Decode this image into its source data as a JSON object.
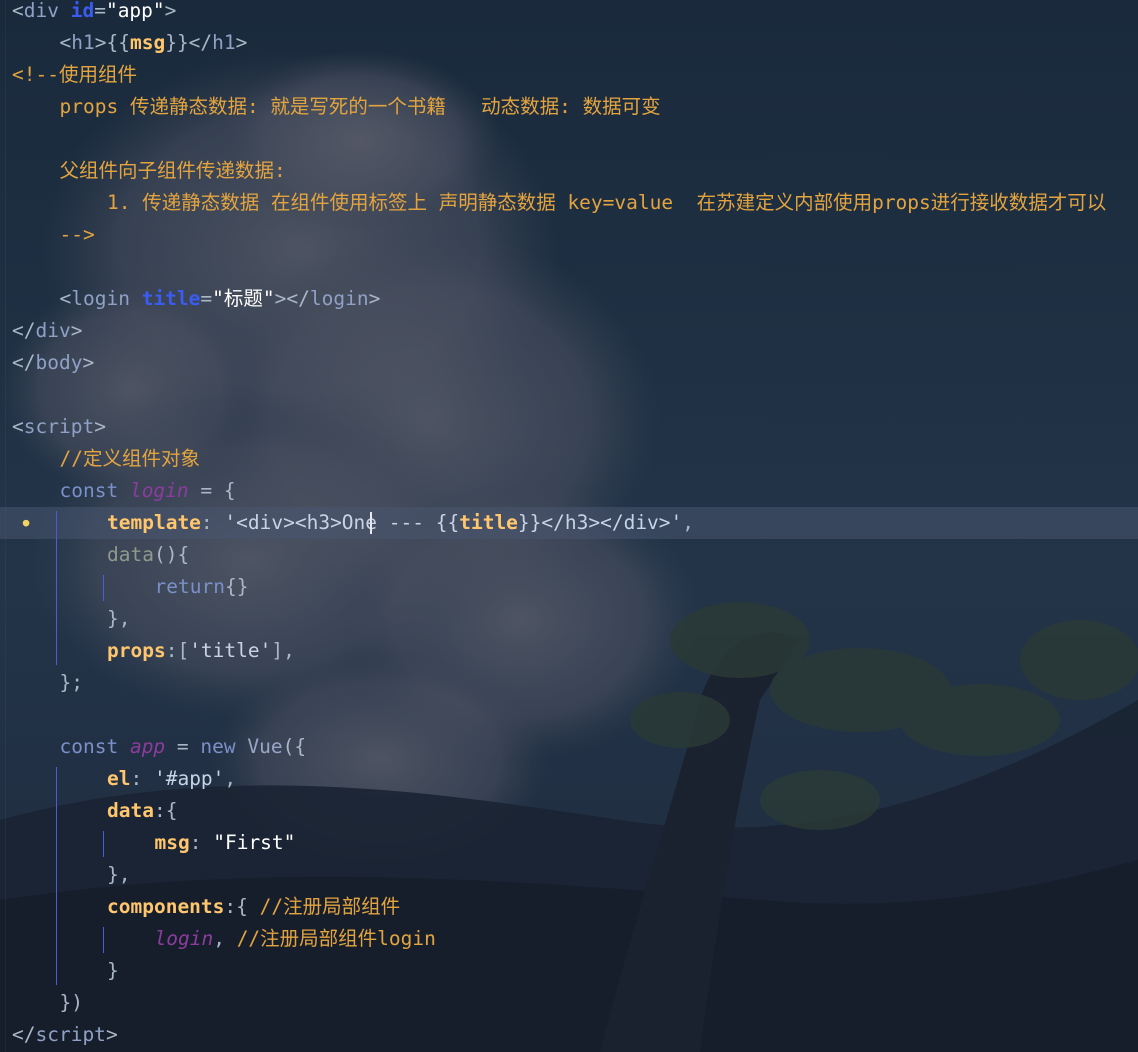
{
  "editor": {
    "lines": [
      {
        "y": 0,
        "indent": 0,
        "tokens": [
          [
            "tag",
            "<"
          ],
          [
            "tagname",
            "div "
          ],
          [
            "attr-kw",
            "id"
          ],
          [
            "tag",
            "="
          ],
          [
            "str",
            "\"app\""
          ],
          [
            "tag",
            ">"
          ]
        ]
      },
      {
        "y": 1,
        "indent": 1,
        "tokens": [
          [
            "tag",
            "<"
          ],
          [
            "tagname",
            "h1"
          ],
          [
            "tag",
            ">{{"
          ],
          [
            "prop",
            "msg"
          ],
          [
            "tag",
            "}}</"
          ],
          [
            "tagname",
            "h1"
          ],
          [
            "tag",
            ">"
          ]
        ]
      },
      {
        "y": 2,
        "indent": 0,
        "tokens": [
          [
            "comment",
            "<!--使用组件"
          ]
        ]
      },
      {
        "y": 3,
        "indent": 1,
        "tokens": [
          [
            "comment",
            "props 传递静态数据: 就是写死的一个书籍   动态数据: 数据可变"
          ]
        ]
      },
      {
        "y": 4,
        "indent": 0,
        "tokens": []
      },
      {
        "y": 5,
        "indent": 1,
        "tokens": [
          [
            "comment",
            "父组件向子组件传递数据:"
          ]
        ]
      },
      {
        "y": 6,
        "indent": 2,
        "tokens": [
          [
            "comment",
            "1. 传递静态数据 在组件使用标签上 声明静态数据 key=value  在苏建定义内部使用props进行接收数据才可以"
          ]
        ]
      },
      {
        "y": 7,
        "indent": 1,
        "tokens": [
          [
            "comment",
            "-->"
          ]
        ]
      },
      {
        "y": 8,
        "indent": 0,
        "tokens": []
      },
      {
        "y": 9,
        "indent": 1,
        "tokens": [
          [
            "tag",
            "<"
          ],
          [
            "tagname",
            "login "
          ],
          [
            "attr-kw",
            "title"
          ],
          [
            "tag",
            "="
          ],
          [
            "str",
            "\"标题\""
          ],
          [
            "tag",
            "></"
          ],
          [
            "tagname",
            "login"
          ],
          [
            "tag",
            ">"
          ]
        ]
      },
      {
        "y": 10,
        "indent": 0,
        "tokens": [
          [
            "tag",
            "</"
          ],
          [
            "tagname",
            "div"
          ],
          [
            "tag",
            ">"
          ]
        ]
      },
      {
        "y": 11,
        "indent": 0,
        "tokens": [
          [
            "tag",
            "</"
          ],
          [
            "tagname",
            "body"
          ],
          [
            "tag",
            ">"
          ]
        ]
      },
      {
        "y": 12,
        "indent": 0,
        "tokens": []
      },
      {
        "y": 13,
        "indent": 0,
        "tokens": [
          [
            "tag",
            "<"
          ],
          [
            "tagname",
            "script"
          ],
          [
            "tag",
            ">"
          ]
        ]
      },
      {
        "y": 14,
        "indent": 1,
        "tokens": [
          [
            "comment",
            "//定义组件对象"
          ]
        ]
      },
      {
        "y": 15,
        "indent": 1,
        "tokens": [
          [
            "kw",
            "const "
          ],
          [
            "purple",
            "login"
          ],
          [
            "tag",
            " = {"
          ]
        ]
      },
      {
        "y": 16,
        "indent": 2,
        "current": true,
        "tokens": [
          [
            "prop",
            "template"
          ],
          [
            "tag",
            ": "
          ],
          [
            "sq",
            "'<div><h3>One --- {{"
          ],
          [
            "prop",
            "title"
          ],
          [
            "sq",
            "}}</h3></div>'"
          ],
          [
            "tag",
            ","
          ]
        ]
      },
      {
        "y": 17,
        "indent": 2,
        "tokens": [
          [
            "muted",
            "data"
          ],
          [
            "tag",
            "(){"
          ]
        ]
      },
      {
        "y": 18,
        "indent": 3,
        "tokens": [
          [
            "kw",
            "return"
          ],
          [
            "tag",
            "{}"
          ]
        ]
      },
      {
        "y": 19,
        "indent": 2,
        "tokens": [
          [
            "tag",
            "},"
          ]
        ]
      },
      {
        "y": 20,
        "indent": 2,
        "tokens": [
          [
            "prop",
            "props"
          ],
          [
            "tag",
            ":["
          ],
          [
            "sq",
            "'title'"
          ],
          [
            "tag",
            "],"
          ]
        ]
      },
      {
        "y": 21,
        "indent": 1,
        "tokens": [
          [
            "tag",
            "};"
          ]
        ]
      },
      {
        "y": 22,
        "indent": 0,
        "tokens": []
      },
      {
        "y": 23,
        "indent": 1,
        "tokens": [
          [
            "kw",
            "const "
          ],
          [
            "purple",
            "app"
          ],
          [
            "tag",
            " = "
          ],
          [
            "kw",
            "new "
          ],
          [
            "fn",
            "Vue"
          ],
          [
            "tag",
            "({"
          ]
        ]
      },
      {
        "y": 24,
        "indent": 2,
        "tokens": [
          [
            "prop",
            "el"
          ],
          [
            "tag",
            ": "
          ],
          [
            "sq",
            "'#app'"
          ],
          [
            "tag",
            ","
          ]
        ]
      },
      {
        "y": 25,
        "indent": 2,
        "tokens": [
          [
            "prop",
            "data"
          ],
          [
            "tag",
            ":{"
          ]
        ]
      },
      {
        "y": 26,
        "indent": 3,
        "tokens": [
          [
            "prop",
            "msg"
          ],
          [
            "tag",
            ": "
          ],
          [
            "str",
            "\"First\""
          ]
        ]
      },
      {
        "y": 27,
        "indent": 2,
        "tokens": [
          [
            "tag",
            "},"
          ]
        ]
      },
      {
        "y": 28,
        "indent": 2,
        "tokens": [
          [
            "prop",
            "components"
          ],
          [
            "tag",
            ":{ "
          ],
          [
            "comment",
            "//注册局部组件"
          ]
        ]
      },
      {
        "y": 29,
        "indent": 3,
        "tokens": [
          [
            "purple",
            "login"
          ],
          [
            "tag",
            ", "
          ],
          [
            "comment",
            "//注册局部组件login"
          ]
        ]
      },
      {
        "y": 30,
        "indent": 2,
        "tokens": [
          [
            "tag",
            "}"
          ]
        ]
      },
      {
        "y": 31,
        "indent": 1,
        "tokens": [
          [
            "tag",
            "})"
          ]
        ]
      },
      {
        "y": 32,
        "indent": 0,
        "tokens": [
          [
            "tag",
            "</"
          ],
          [
            "tagname",
            "script"
          ],
          [
            "tag",
            ">"
          ]
        ]
      }
    ],
    "lightbulb_icon": "lightbulb-icon",
    "colors": {
      "background": "#1d2a3a",
      "comment": "#e3a43f",
      "property": "#ffc66d",
      "keyword": "#7a90c8",
      "attribute": "#3a5cf0",
      "identifier": "#8c3c9c",
      "guide": "#4f5bd6"
    }
  }
}
